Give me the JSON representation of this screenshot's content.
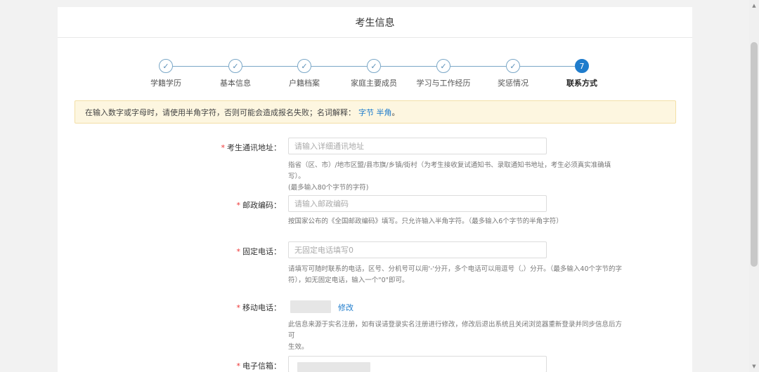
{
  "page": {
    "title": "考生信息"
  },
  "stepper": {
    "steps": [
      {
        "label": "学籍学历",
        "icon": "check-icon",
        "state": "done"
      },
      {
        "label": "基本信息",
        "icon": "check-icon",
        "state": "done"
      },
      {
        "label": "户籍档案",
        "icon": "check-icon",
        "state": "done"
      },
      {
        "label": "家庭主要成员",
        "icon": "check-icon",
        "state": "done"
      },
      {
        "label": "学习与工作经历",
        "icon": "check-icon",
        "state": "done"
      },
      {
        "label": "奖惩情况",
        "icon": "check-icon",
        "state": "done"
      },
      {
        "label": "联系方式",
        "number": "7",
        "state": "active"
      }
    ],
    "check_glyph": "✓"
  },
  "notice": {
    "text": "在输入数字或字母时，请使用半角字符，否则可能会造成报名失败；名词解释：",
    "link_text": "字节 半角",
    "suffix": "。"
  },
  "form": {
    "required_mark": "*",
    "address": {
      "label": "考生通讯地址：",
      "placeholder": "请输入详细通讯地址",
      "hint_line1": "指省（区、市）/地市区盟/县市旗/乡镇/街村（为考生接收复试通知书、录取通知书地址，考生必须真实准确填写）。",
      "hint_line2": "(最多输入80个字节的字符)"
    },
    "postcode": {
      "label": "邮政编码：",
      "placeholder": "请输入邮政编码",
      "hint_line1": "按国家公布的《全国邮政编码》填写。只允许输入半角字符。（最多输入6个字节的半角字符）"
    },
    "phone": {
      "label": "固定电话：",
      "placeholder": "无固定电话填写0",
      "hint_line1": "请填写可随时联系的电话，区号、分机号可以用'-'分开，多个电话可以用逗号（,）分开。（最多输入40个字节的字",
      "hint_line2": "符），如无固定电话，输入一个\"0\"即可。"
    },
    "mobile": {
      "label": "移动电话：",
      "modify_label": "修改",
      "hint_line1": "此信息来源于实名注册，如有误请登录实名注册进行修改，修改后退出系统且关闭浏览器重新登录并同步信息后方可",
      "hint_line2": "生效。"
    },
    "email": {
      "label": "电子信箱："
    }
  },
  "colors": {
    "accent": "#1f7ccc",
    "required": "#e33333",
    "notice_bg": "#fdf6e0"
  }
}
